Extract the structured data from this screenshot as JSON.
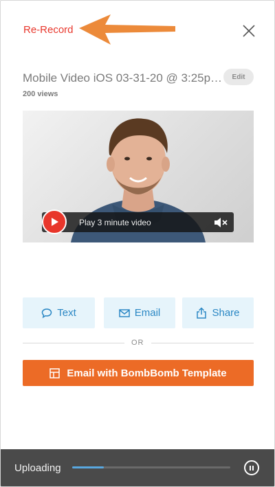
{
  "header": {
    "rerecord_label": "Re-Record",
    "accent_color": "#e8362b",
    "arrow_color": "#ec8a3a",
    "close_icon": "close-icon"
  },
  "video_info": {
    "title": "Mobile Video iOS 03-31-20 @ 3:25p…",
    "views": "200 views",
    "edit_label": "Edit"
  },
  "player": {
    "play_label": "Play 3 minute video",
    "play_icon": "play-icon",
    "mute_icon": "mute-icon"
  },
  "actions": [
    {
      "label": "Text",
      "icon": "speech-bubble-icon"
    },
    {
      "label": "Email",
      "icon": "envelope-icon"
    },
    {
      "label": "Share",
      "icon": "share-icon"
    }
  ],
  "divider_text": "OR",
  "template_button": {
    "label": "Email with BombBomb Template",
    "icon": "template-icon",
    "color": "#ec6b26"
  },
  "upload": {
    "label": "Uploading",
    "progress": 0.2,
    "pause_icon": "pause-icon"
  }
}
